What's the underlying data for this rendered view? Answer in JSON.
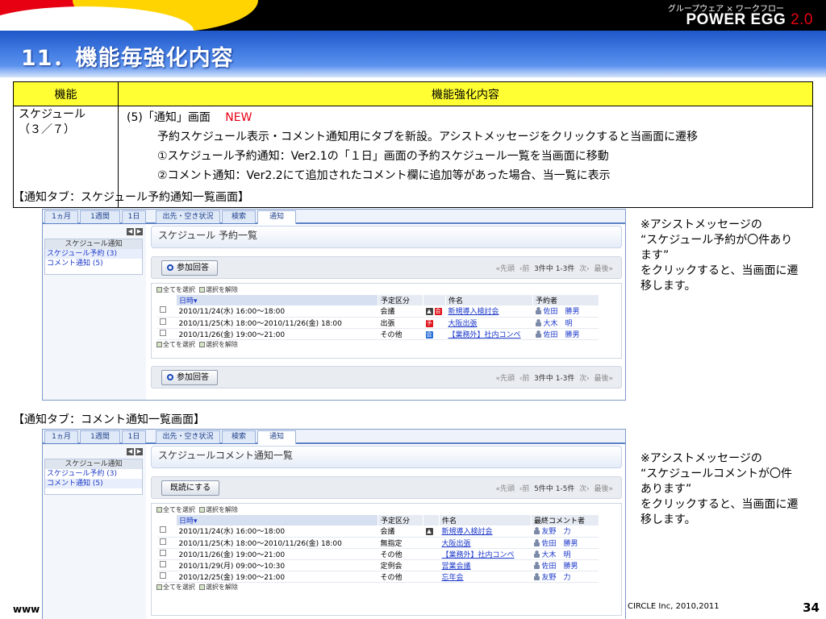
{
  "brand": {
    "tagline": "グループウェア × ワークフロー",
    "name": "POWER EGG",
    "version": "2.0"
  },
  "slide": {
    "title": "11．機能毎強化内容",
    "page_number": "34",
    "footer_left": "www",
    "footer_copyright": "CIRCLE  Inc, 2010,2011"
  },
  "feature_table": {
    "headers": [
      "機能",
      "機能強化内容"
    ],
    "row": {
      "feature": "スケジュール",
      "feature_sub": "（３／７）",
      "heading": "(5)「通知」画面",
      "new_label": "NEW",
      "lines": [
        "予約スケジュール表示・コメント通知用にタブを新設。アシストメッセージをクリックすると当画面に遷移",
        "①スケジュール予約通知：Ver2.1の「１日」画面の予約スケジュール一覧を当画面に移動",
        "②コメント通知：Ver2.2にて追加されたコメント欄に追加等があった場合、当一覧に表示"
      ]
    }
  },
  "tabs": [
    "1ヵ月",
    "1週間",
    "1日",
    "出先・空き状況",
    "検索",
    "通知"
  ],
  "sidebar": {
    "nav": [
      "◀",
      "▶"
    ],
    "header": "スケジュール通知",
    "items": [
      "スケジュール予約 (3)",
      "コメント通知 (5)"
    ]
  },
  "select_all": "全てを選択",
  "deselect_all": "選択を解除",
  "section1": {
    "label": "【通知タブ：スケジュール予約通知一覧画面】",
    "page_title": "スケジュール 予約一覧",
    "button": "参加回答",
    "pager": {
      "first": "«先頭",
      "prev": "‹前",
      "info": "3件中 1-3件",
      "next": "次›",
      "last": "最後»"
    },
    "columns": [
      "日時",
      "予定区分",
      "",
      "件名",
      "予約者"
    ],
    "rows": [
      {
        "datetime": "2010/11/24(水) 16:00〜18:00",
        "category": "会議",
        "icon": "会",
        "title": "新規導入検討会",
        "user": "佐田　勝男"
      },
      {
        "datetime": "2010/11/25(木) 18:00〜2010/11/26(金) 18:00",
        "category": "出張",
        "icon": "予",
        "title": "大阪出張",
        "user": "大木　明"
      },
      {
        "datetime": "2010/11/26(金) 19:00〜21:00",
        "category": "その他",
        "icon": "会",
        "title": "【業務外】社内コンペ",
        "user": "佐田　勝男"
      }
    ],
    "note": [
      "※アシストメッセージの",
      "“スケジュール予約が〇件あります”",
      "をクリックすると、当画面に遷移します。"
    ]
  },
  "section2": {
    "label": "【通知タブ：コメント通知一覧画面】",
    "page_title": "スケジュールコメント通知一覧",
    "button": "既読にする",
    "pager": {
      "first": "«先頭",
      "prev": "‹前",
      "info": "5件中 1-5件",
      "next": "次›",
      "last": "最後»"
    },
    "columns": [
      "日時",
      "予定区分",
      "",
      "件名",
      "最終コメント者"
    ],
    "rows": [
      {
        "datetime": "2010/11/24(水) 16:00〜18:00",
        "category": "会議",
        "title": "新規導入検討会",
        "user": "友野　力"
      },
      {
        "datetime": "2010/11/25(木) 18:00〜2010/11/26(金) 18:00",
        "category": "無指定",
        "title": "大阪出張",
        "user": "佐田　勝男"
      },
      {
        "datetime": "2010/11/26(金) 19:00〜21:00",
        "category": "その他",
        "title": "【業務外】社内コンペ",
        "user": "大木　明"
      },
      {
        "datetime": "2010/11/29(月) 09:00〜10:30",
        "category": "定例会",
        "title": "営業会議",
        "user": "佐田　勝男"
      },
      {
        "datetime": "2010/12/25(金) 19:00〜21:00",
        "category": "その他",
        "title": "忘年会",
        "user": "友野　力"
      }
    ],
    "note": [
      "※アシストメッセージの",
      "“スケジュールコメントが〇件あります”",
      "をクリックすると、当画面に遷移します。"
    ]
  }
}
